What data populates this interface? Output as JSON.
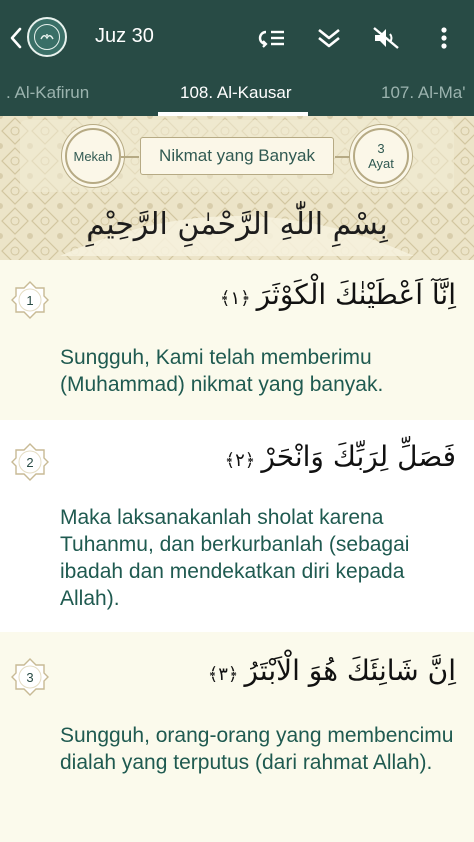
{
  "app_bar": {
    "title": "Juz 30",
    "icons": [
      "back-icon",
      "quran-logo",
      "repeat-list-icon",
      "scroll-down-icon",
      "mute-icon",
      "more-icon"
    ]
  },
  "tabs": {
    "prev": ". Al-Kafirun",
    "current": "108. Al-Kausar",
    "next": "107. Al-Ma'"
  },
  "surah_header": {
    "place": "Mekah",
    "meaning": "Nikmat yang Banyak",
    "ayat_count": "3",
    "ayat_label": "Ayat",
    "basmala": "بِسْمِ اللّٰهِ الرَّحْمٰنِ الرَّحِيْمِ"
  },
  "ayahs": [
    {
      "number": "1",
      "arabic": "اِنَّآ اَعْطَيْنٰكَ الْكَوْثَرَ",
      "end_mark": "﴿١﴾",
      "translation": "Sungguh, Kami telah memberimu (Muhammad) nikmat yang banyak."
    },
    {
      "number": "2",
      "arabic": "فَصَلِّ لِرَبِّكَ وَانْحَرْ",
      "end_mark": "﴿٢﴾",
      "translation": "Maka laksanakanlah sholat karena Tuhanmu, dan berkurbanlah (sebagai ibadah dan mendekatkan diri kepada Allah)."
    },
    {
      "number": "3",
      "arabic": "اِنَّ شَانِئَكَ هُوَ الْاَبْتَرُ",
      "end_mark": "﴿٣﴾",
      "translation": "Sungguh, orang-orang yang membencimu dialah yang terputus (dari rahmat Allah)."
    }
  ],
  "colors": {
    "primary": "#284b45",
    "translation_text": "#1f5a50",
    "header_pattern": "#ece4c8"
  }
}
